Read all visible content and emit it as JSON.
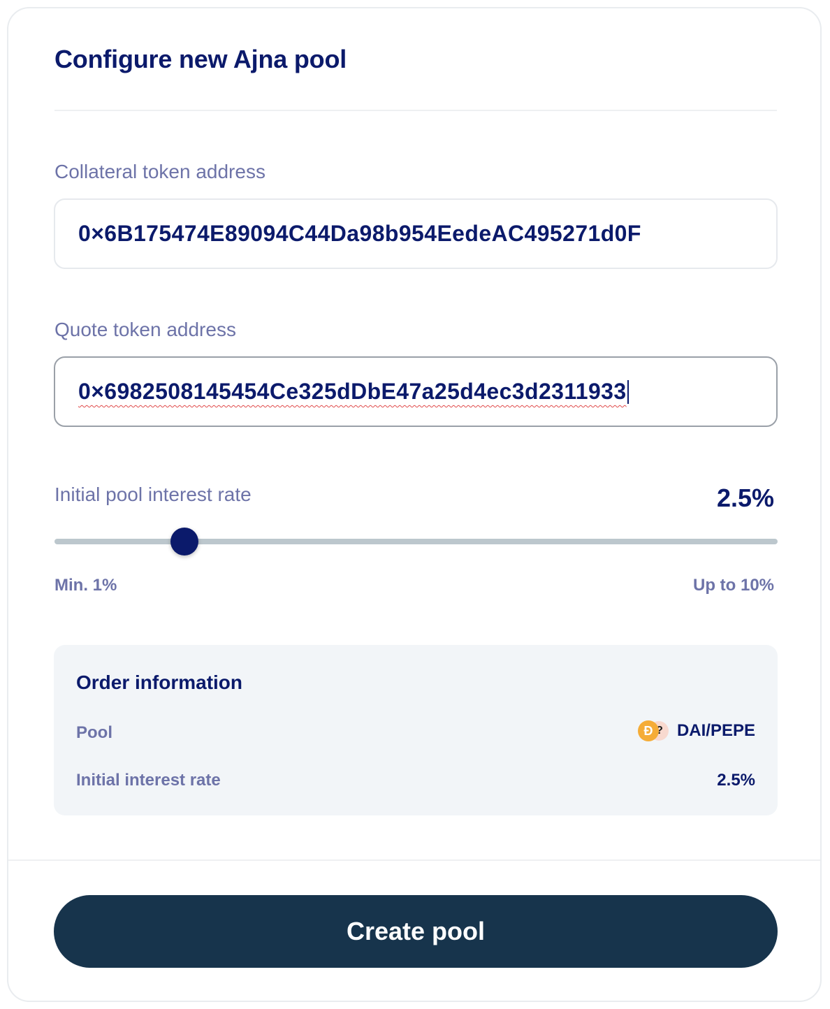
{
  "title": "Configure new Ajna pool",
  "collateral": {
    "label": "Collateral token address",
    "value": "0×6B175474E89094C44Da98b954EedeAC495271d0F"
  },
  "quote": {
    "label": "Quote token address",
    "value": "0×6982508145454Ce325dDbE47a25d4ec3d2311933"
  },
  "interest": {
    "label": "Initial pool interest rate",
    "value": "2.5%",
    "slider_fraction": 0.18,
    "min_label": "Min. 1%",
    "max_label": "Up to 10%"
  },
  "order": {
    "title": "Order information",
    "pool_label": "Pool",
    "pool_value": "DAI/PEPE",
    "pool_icons": [
      "dai-token-icon",
      "pepe-token-icon"
    ],
    "rate_label": "Initial interest rate",
    "rate_value": "2.5%"
  },
  "create_button": "Create pool",
  "colors": {
    "navy": "#0b1a6b",
    "muted": "#6d73a8",
    "button": "#17344c",
    "track": "#bcc7cd",
    "order_bg": "#f2f5f8",
    "dai": "#f5ac37"
  }
}
